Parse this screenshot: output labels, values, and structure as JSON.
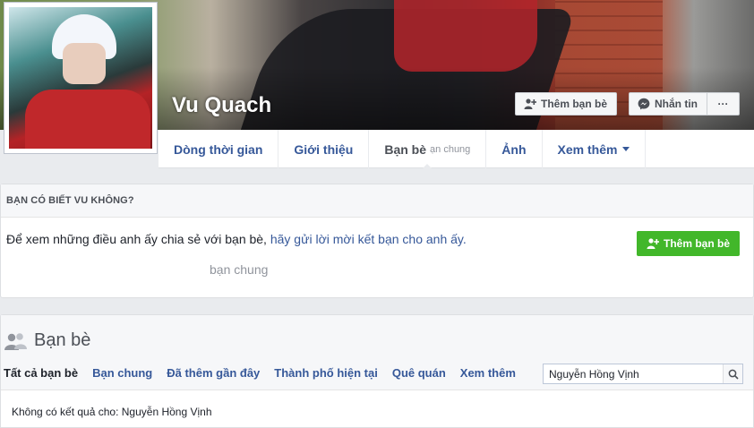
{
  "profile": {
    "name": "Vu Quach"
  },
  "cover_buttons": {
    "add_friend": "Thêm bạn bè",
    "message": "Nhắn tin",
    "more": "···"
  },
  "tabs": [
    {
      "label": "Dòng thời gian"
    },
    {
      "label": "Giới thiệu"
    },
    {
      "label": "Bạn bè",
      "sub": "ạn chung"
    },
    {
      "label": "Ảnh"
    },
    {
      "label": "Xem thêm"
    }
  ],
  "know_card": {
    "header": "BẠN CÓ BIẾT VU KHÔNG?",
    "message_prefix": "Để xem những điều anh ấy chia sẻ với bạn bè, ",
    "message_link": "hãy gửi lời mời kết bạn cho anh ấy.",
    "add_friend_button": "Thêm bạn bè"
  },
  "tooltip": "bạn chung",
  "friends": {
    "title": "Bạn bè",
    "subtabs": [
      "Tất cả bạn bè",
      "Bạn chung",
      "Đã thêm gần đây",
      "Thành phố hiện tại",
      "Quê quán",
      "Xem thêm"
    ],
    "search_value": "Nguyễn Hồng Vịnh",
    "no_result": "Không có kết quả cho: Nguyễn Hồng Vịnh"
  },
  "colors": {
    "link": "#365899",
    "green": "#42b72a",
    "background": "#e9ebee"
  },
  "icons": [
    "add-friend-icon",
    "messenger-icon",
    "more-icon",
    "friends-icon",
    "search-icon",
    "chevron-down-icon"
  ]
}
